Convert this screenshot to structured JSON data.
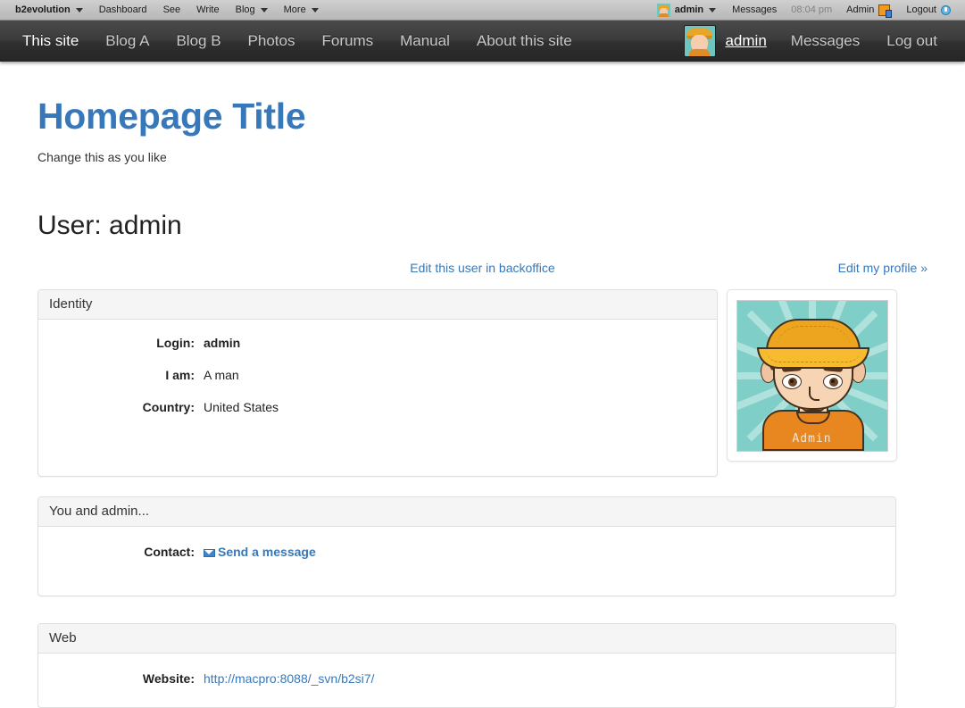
{
  "evobar": {
    "brand": "b2evolution",
    "left_items": [
      {
        "label": "b2evolution",
        "caret": true,
        "bold": true
      },
      {
        "label": "Dashboard",
        "caret": false,
        "bold": false
      },
      {
        "label": "See",
        "caret": false,
        "bold": false
      },
      {
        "label": "Write",
        "caret": false,
        "bold": false
      },
      {
        "label": "Blog",
        "caret": true,
        "bold": false
      },
      {
        "label": "More",
        "caret": true,
        "bold": false
      }
    ],
    "user": "admin",
    "messages": "Messages",
    "time": "08:04 pm",
    "admin": "Admin",
    "logout": "Logout"
  },
  "nav": {
    "items": [
      {
        "label": "This site",
        "active": true
      },
      {
        "label": "Blog A",
        "active": false
      },
      {
        "label": "Blog B",
        "active": false
      },
      {
        "label": "Photos",
        "active": false
      },
      {
        "label": "Forums",
        "active": false
      },
      {
        "label": "Manual",
        "active": false
      },
      {
        "label": "About this site",
        "active": false
      }
    ],
    "user": "admin",
    "messages": "Messages",
    "logout": "Log out"
  },
  "header": {
    "site_title": "Homepage Title",
    "tagline": "Change this as you like"
  },
  "main": {
    "page_title": "User: admin",
    "edit_backoffice_link": "Edit this user in backoffice",
    "edit_profile_link": "Edit my profile »",
    "identity": {
      "heading": "Identity",
      "fields": [
        {
          "label": "Login:",
          "value": "admin"
        },
        {
          "label": "I am:",
          "value": "A man"
        },
        {
          "label": "Country:",
          "value": "United States"
        }
      ]
    },
    "avatar": {
      "name": "Admin"
    },
    "contact": {
      "heading": "You and admin...",
      "field_label": "Contact:",
      "send_message_link": "Send a message"
    },
    "web": {
      "heading": "Web",
      "field_label": "Website:",
      "website_url": "http://macpro:8088/_svn/b2si7/"
    }
  },
  "colors": {
    "link_blue": "#3778bb",
    "evobar_gray": "#c3c3c3",
    "nav_dark": "#3c3c3c",
    "panel_heading": "#f5f5f5"
  }
}
